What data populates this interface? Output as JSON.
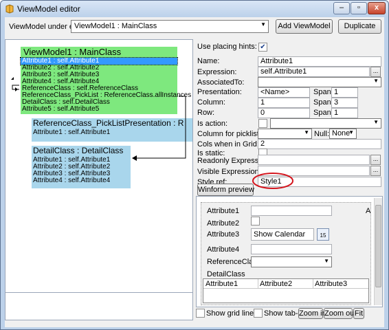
{
  "window": {
    "title": "ViewModel editor",
    "minimize_icon": "minimize-icon",
    "maximize_icon": "maximize-icon",
    "close_icon": "close-icon",
    "minimize_label": "–",
    "maximize_label": "▫",
    "close_label": "x"
  },
  "toolbar": {
    "vm_label": "ViewModel under edit:",
    "vm_value": "ViewModel1 : MainClass",
    "add_button": "Add ViewModel",
    "duplicate_button": "Duplicate"
  },
  "canvas": {
    "main_box": {
      "title": "ViewModel1 : MainClass",
      "rows": [
        "Attribute1 : self.Attribute1",
        "Attribute2 : self.Attribute2",
        "Attribute3 : self.Attribute3",
        "Attribute4 : self.Attribute4",
        "ReferenceClass : self.ReferenceClass",
        "ReferenceClass_PickList : ReferenceClass.allInstances",
        "DetailClass : self.DetailClass",
        "Attribute5 : self.Attribute5"
      ]
    },
    "picklist_box": {
      "title": "ReferenceClass_PickListPresentation : R",
      "rows": [
        "Attribute1 : self.Attribute1"
      ]
    },
    "detail_box": {
      "title": "DetailClass : DetailClass",
      "rows": [
        "Attribute1 : self.Attribute1",
        "Attribute2 : self.Attribute2",
        "Attribute3 : self.Attribute3",
        "Attribute4 : self.Attribute4"
      ]
    }
  },
  "props": {
    "use_hints_label": "Use placing hints:",
    "name_label": "Name:",
    "name_value": "Attribute1",
    "expression_label": "Expression:",
    "expression_value": "self.Attribute1",
    "associated_label": "AssociatedTo:",
    "associated_value": "",
    "presentation_label": "Presentation:",
    "presentation_value": "<Name>",
    "span_label": "Span:",
    "presentation_span": "1",
    "column_label": "Column:",
    "column_value": "1",
    "column_span": "3",
    "row_label": "Row:",
    "row_value": "0",
    "row_span": "1",
    "is_action_label": "Is action:",
    "column_picklist_label": "Column for picklist:",
    "null_label": "Null:",
    "null_value": "None",
    "cols_grid_label": "Cols when in Grid:",
    "cols_grid_value": "2",
    "is_static_label": "Is static:",
    "readonly_label": "Readonly Expression:",
    "visible_label": "Visible Expression:",
    "style_label": "Style ref:",
    "style_value": "Style1",
    "winform_button": "Winform preview",
    "ellipsis": "..."
  },
  "preview": {
    "labels": [
      "Attribute1",
      "Attribute2",
      "Attribute3",
      "Attribute4",
      "ReferenceClass",
      "DetailClass"
    ],
    "calendar_text": "Show Calendar",
    "calendar_day": "15",
    "grid_cols": [
      "Attribute1",
      "Attribute2",
      "Attribute3"
    ],
    "edge_char": "A"
  },
  "bottom": {
    "grid_lines": "Show grid lines",
    "tab_order": "Show tab-order",
    "zoom_in": "Zoom in",
    "zoom_out": "Zoom out",
    "fit": "Fit"
  }
}
